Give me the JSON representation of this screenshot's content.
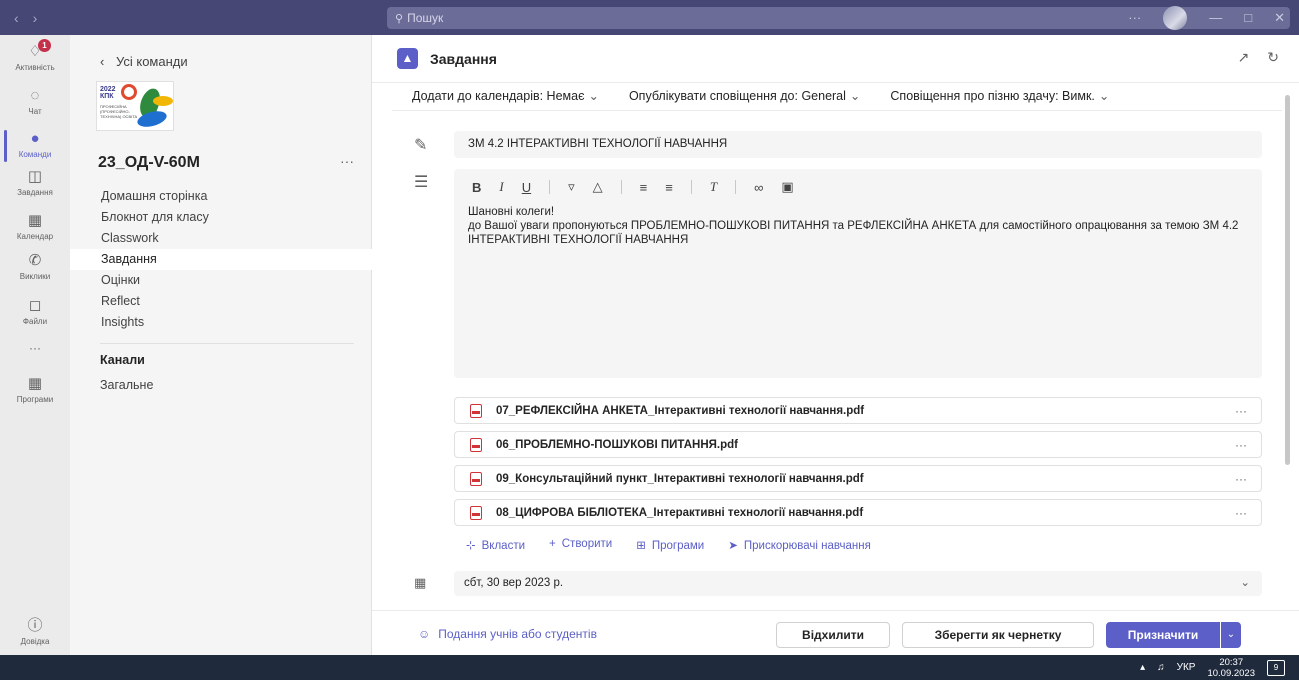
{
  "titlebar": {
    "search_placeholder": "Пошук",
    "more": "···"
  },
  "rail": {
    "items": [
      {
        "label": "Активність",
        "icon": "bell-icon",
        "badge": "1"
      },
      {
        "label": "Чат",
        "icon": "chat-icon"
      },
      {
        "label": "Команди",
        "icon": "teams-icon",
        "active": true
      },
      {
        "label": "Завдання",
        "icon": "assignments-icon"
      },
      {
        "label": "Календар",
        "icon": "calendar-icon"
      },
      {
        "label": "Виклики",
        "icon": "phone-icon"
      },
      {
        "label": "Файли",
        "icon": "file-icon"
      },
      {
        "label": "···",
        "icon": "more-icon"
      },
      {
        "label": "Програми",
        "icon": "apps-icon"
      }
    ],
    "help_label": "Довідка"
  },
  "teampanel": {
    "back_label": "Усі команди",
    "logo_text_year": "2022",
    "logo_text_abbr": "КПК",
    "logo_text_sub": "ПРОФЕСІЙНА (ПРОФЕСІЙНО-ТЕХНІЧНА) ОСВІТА",
    "team_name": "23_ОД-V-60М",
    "more": "···",
    "nav": [
      "Домашня сторінка",
      "Блокнот для класу",
      "Classwork",
      "Завдання",
      "Оцінки",
      "Reflect",
      "Insights"
    ],
    "channels_heading": "Канали",
    "channel_general": "Загальне"
  },
  "main": {
    "title": "Завдання",
    "options": {
      "calendar": "Додати до календарів: Немає",
      "notify": "Опублікувати сповіщення до: General",
      "late": "Сповіщення про пізню здачу: Вимк."
    },
    "assignment_title": "ЗМ 4.2 ІНТЕРАКТИВНІ ТЕХНОЛОГІЇ НАВЧАННЯ",
    "instructions_line1": "Шановні колеги!",
    "instructions_line2": "до Вашої уваги пропонуються ПРОБЛЕМНО-ПОШУКОВІ ПИТАННЯ та РЕФЛЕКСІЙНА АНКЕТА  для самостійного опрацювання за темою ЗМ 4.2 ІНТЕРАКТИВНІ ТЕХНОЛОГІЇ НАВЧАННЯ",
    "files": [
      "07_РЕФЛЕКСІЙНА АНКЕТА_Інтерактивні технології навчання.pdf",
      "06_ПРОБЛЕМНО-ПОШУКОВІ ПИТАННЯ.pdf",
      "09_Консультаційний пункт_Інтерактивні технології навчання.pdf",
      "08_ЦИФРОВА БІБЛІОТЕКА_Інтерактивні технології навчання.pdf"
    ],
    "file_more": "···",
    "actions": {
      "attach": "Вкласти",
      "create": "Створити",
      "apps": "Програми",
      "accelerators": "Прискорювачі навчання"
    },
    "due_date": "сбт, 30 вер 2023 р."
  },
  "footer": {
    "students": "Подання учнів або студентів",
    "decline": "Відхилити",
    "save_draft": "Зберегти як чернетку",
    "assign": "Призначити"
  },
  "taskbar": {
    "lang": "УКР",
    "time": "20:37",
    "date": "10.09.2023",
    "notif_count": "9"
  }
}
